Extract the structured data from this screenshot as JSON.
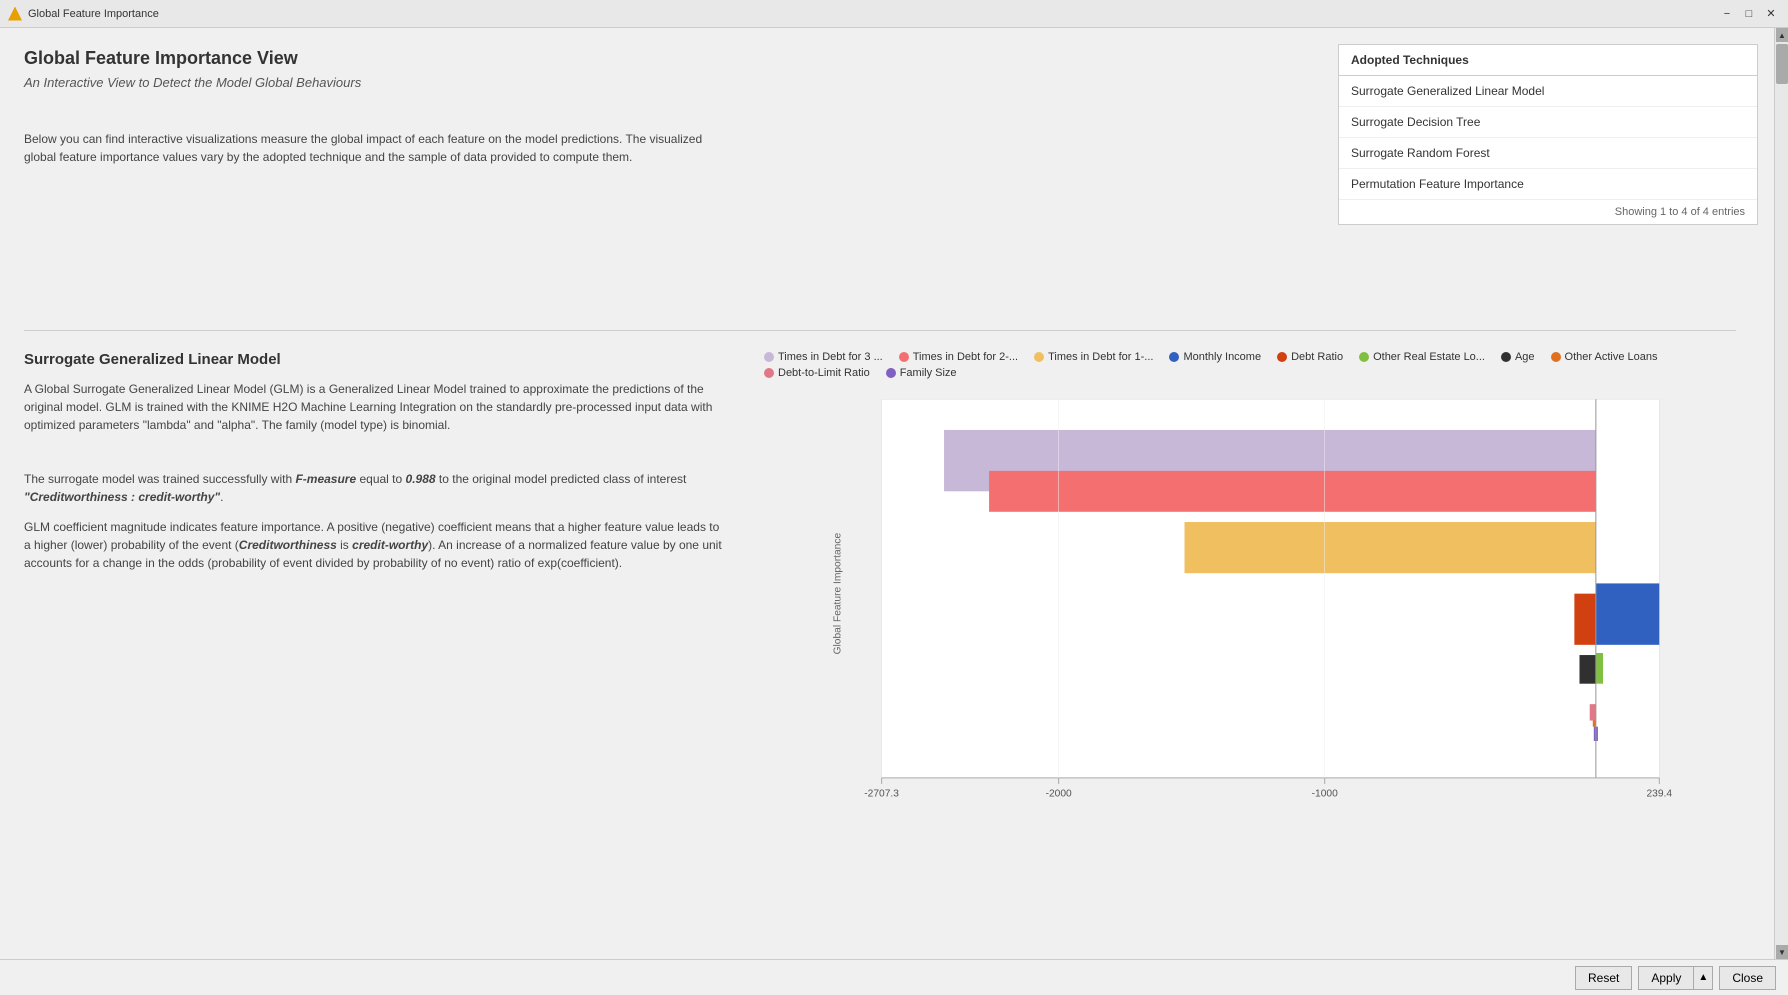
{
  "titleBar": {
    "title": "Global Feature Importance",
    "icon": "triangle-icon",
    "minimizeLabel": "−",
    "maximizeLabel": "□",
    "closeLabel": "✕"
  },
  "page": {
    "title": "Global Feature Importance View",
    "subtitle": "An Interactive View to Detect the Model Global Behaviours",
    "description": "Below you can find interactive visualizations measure the global impact of each feature on the model predictions. The visualized global feature importance values vary by the adopted technique and the sample of data provided to compute them."
  },
  "techniquesPanel": {
    "header": "Adopted Techniques",
    "items": [
      "Surrogate Generalized Linear Model",
      "Surrogate Decision Tree",
      "Surrogate Random Forest",
      "Permutation Feature Importance"
    ],
    "footer": "Showing 1 to 4 of 4 entries"
  },
  "section": {
    "title": "Surrogate Generalized Linear Model",
    "description1": "A Global Surrogate Generalized Linear Model (GLM) is a Generalized Linear Model trained to approximate the predictions of the original model. GLM is trained with the KNIME H2O Machine Learning Integration on the standardly pre-processed input data with optimized parameters \"lambda\" and \"alpha\". The family (model type) is binomial.",
    "fmeasure": "The surrogate model was trained successfully with F-measure equal to 0.988 to the original model predicted class of interest \"Creditworthiness : credit-worthy\".",
    "note": "GLM coefficient magnitude indicates feature importance. A positive (negative) coefficient means that a higher feature value leads to a higher (lower) probability of the event (Creditworthiness is credit-worthy). An increase of a normalized feature value by one unit accounts for a change in the odds (probability of event divided by probability of no event) ratio of exp(coefficient)."
  },
  "chart": {
    "xAxisMin": "-2707.3",
    "xAxisMax": "239.4",
    "xAxisLabels": [
      "-2707.3",
      "-2000",
      "-1000",
      "239.4"
    ],
    "yAxisLabel": "Global Feature Importance",
    "legend": [
      {
        "label": "Times in Debt for 3 ...",
        "color": "#c8b8d8"
      },
      {
        "label": "Times in Debt for 2-...",
        "color": "#f47070"
      },
      {
        "label": "Times in Debt for 1-...",
        "color": "#f0c060"
      },
      {
        "label": "Monthly Income",
        "color": "#3060c0"
      },
      {
        "label": "Debt Ratio",
        "color": "#d04010"
      },
      {
        "label": "Other Real Estate Lo...",
        "color": "#80c040"
      },
      {
        "label": "Age",
        "color": "#303030"
      },
      {
        "label": "Other Active Loans",
        "color": "#e07020"
      },
      {
        "label": "Debt-to-Limit Ratio",
        "color": "#e07888"
      },
      {
        "label": "Family Size",
        "color": "#8060c0"
      }
    ]
  },
  "bottomBar": {
    "resetLabel": "Reset",
    "applyLabel": "Apply",
    "closeLabel": "Close"
  }
}
